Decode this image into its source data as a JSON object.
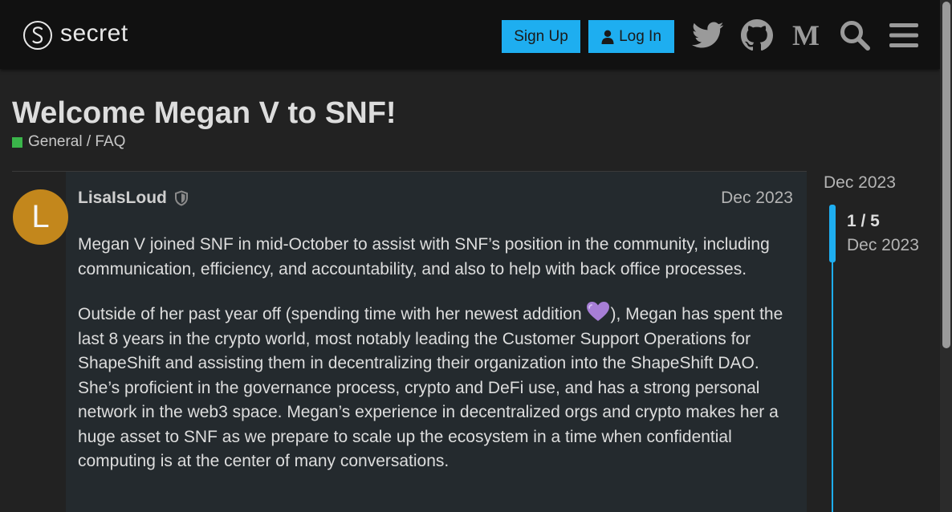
{
  "header": {
    "logo_text": "secret",
    "logo_icon": "secret-s-logo-icon",
    "signup_label": "Sign Up",
    "login_label": "Log In",
    "icons": [
      "twitter-icon",
      "github-icon",
      "medium-icon",
      "search-icon",
      "hamburger-menu-icon"
    ]
  },
  "topic": {
    "title": "Welcome Megan V to SNF!",
    "category": "General / FAQ",
    "category_color": "#3ab54a"
  },
  "post": {
    "avatar_letter": "L",
    "avatar_color": "#c3871c",
    "username": "LisaIsLoud",
    "date": "Dec 2023",
    "paragraph1": "Megan V joined SNF in mid-October to assist with SNF’s position in the community, including communication, efficiency, and accountability, and also to help with back office processes.",
    "paragraph2_before": "Outside of her past year off (spending time with her newest addition ",
    "paragraph2_after": "), Megan has spent the last 8 years in the crypto world, most notably leading the Customer Support Operations for ShapeShift and assisting them in decentralizing their organization into the ShapeShift DAO. She’s proficient in the governance process, crypto and DeFi use, and has a strong personal network in the web3 space. Megan’s experience in decentralized orgs and crypto makes her a huge asset to SNF as we prepare to scale up the ecosystem in a time when confidential computing is at the center of many conversations."
  },
  "timeline": {
    "top_date": "Dec 2023",
    "count": "1 / 5",
    "current_date": "Dec 2023",
    "accent": "#1eaef0"
  }
}
